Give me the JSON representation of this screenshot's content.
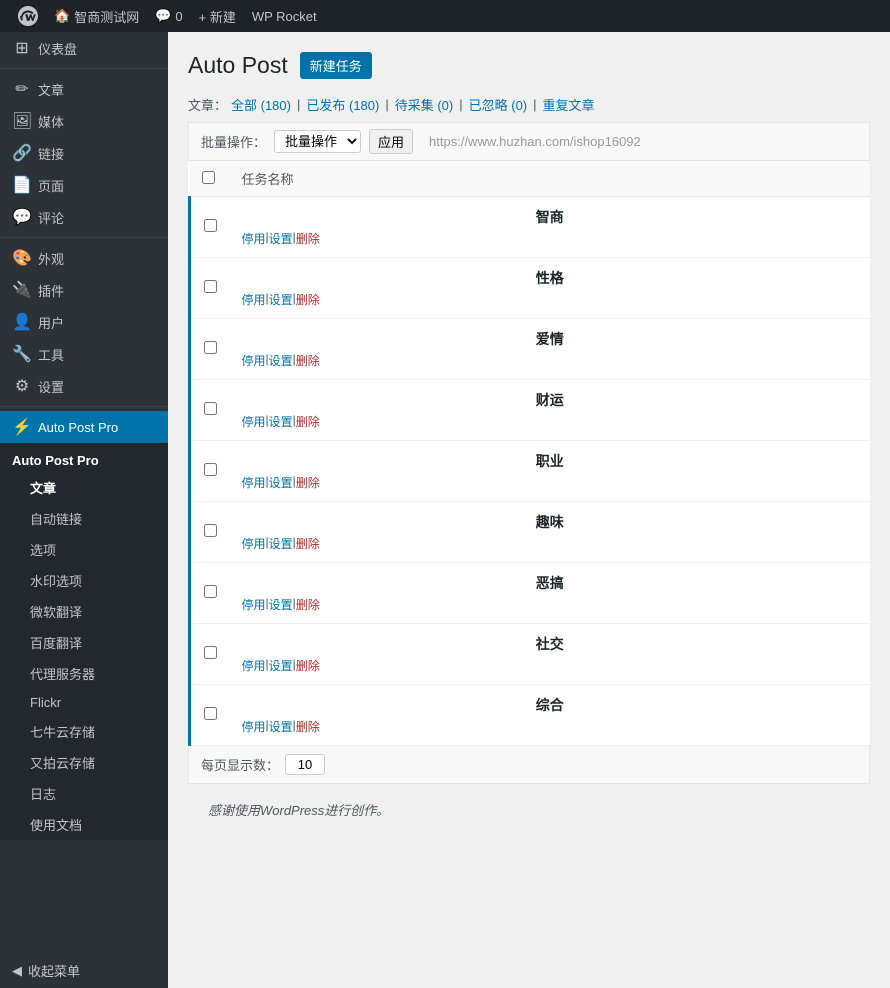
{
  "adminBar": {
    "siteName": "智商测试网",
    "commentCount": "0",
    "newLabel": "+ 新建",
    "wpRocket": "WP Rocket"
  },
  "sidebar": {
    "dashboard": "仪表盘",
    "posts": "文章",
    "media": "媒体",
    "links": "链接",
    "pages": "页面",
    "comments": "评论",
    "appearance": "外观",
    "plugins": "插件",
    "users": "用户",
    "tools": "工具",
    "settings": "设置",
    "autoPostPro": "Auto Post Pro",
    "subMenu": {
      "header": "Auto Post Pro",
      "items": [
        {
          "label": "文章",
          "active": false
        },
        {
          "label": "自动链接",
          "active": false
        },
        {
          "label": "选项",
          "active": false
        },
        {
          "label": "水印选项",
          "active": false
        },
        {
          "label": "微软翻译",
          "active": false
        },
        {
          "label": "百度翻译",
          "active": false
        },
        {
          "label": "代理服务器",
          "active": false
        },
        {
          "label": "Flickr",
          "active": false
        },
        {
          "label": "七牛云存储",
          "active": false
        },
        {
          "label": "又拍云存储",
          "active": false
        },
        {
          "label": "日志",
          "active": false
        },
        {
          "label": "使用文档",
          "active": false
        }
      ]
    },
    "collapseMenu": "收起菜单"
  },
  "page": {
    "title": "Auto Post",
    "newTaskBtn": "新建任务"
  },
  "filterBar": {
    "postLabel": "文章：",
    "all": "全部 (180)",
    "published": "已发布 (180)",
    "pending": "待采集 (0)",
    "ignored": "已忽略 (0)",
    "duplicate": "重复文章"
  },
  "bulkBar": {
    "actionLabel": "批量操作：",
    "applyLabel": "应用",
    "urlHint": "https://www.huzhan.com/ishop16092"
  },
  "table": {
    "checkboxHeader": "",
    "nameHeader": "任务名称",
    "rows": [
      {
        "name": "智商",
        "stop": "停用",
        "settings": "设置",
        "delete": "删除"
      },
      {
        "name": "性格",
        "stop": "停用",
        "settings": "设置",
        "delete": "删除"
      },
      {
        "name": "爱情",
        "stop": "停用",
        "settings": "设置",
        "delete": "删除"
      },
      {
        "name": "财运",
        "stop": "停用",
        "settings": "设置",
        "delete": "删除"
      },
      {
        "name": "职业",
        "stop": "停用",
        "settings": "设置",
        "delete": "删除"
      },
      {
        "name": "趣味",
        "stop": "停用",
        "settings": "设置",
        "delete": "删除"
      },
      {
        "name": "恶搞",
        "stop": "停用",
        "settings": "设置",
        "delete": "删除"
      },
      {
        "name": "社交",
        "stop": "停用",
        "settings": "设置",
        "delete": "删除"
      },
      {
        "name": "综合",
        "stop": "停用",
        "settings": "设置",
        "delete": "删除"
      }
    ]
  },
  "pagination": {
    "label": "每页显示数：",
    "value": "10"
  },
  "footer": {
    "text": "感谢使用WordPress进行创作。"
  }
}
